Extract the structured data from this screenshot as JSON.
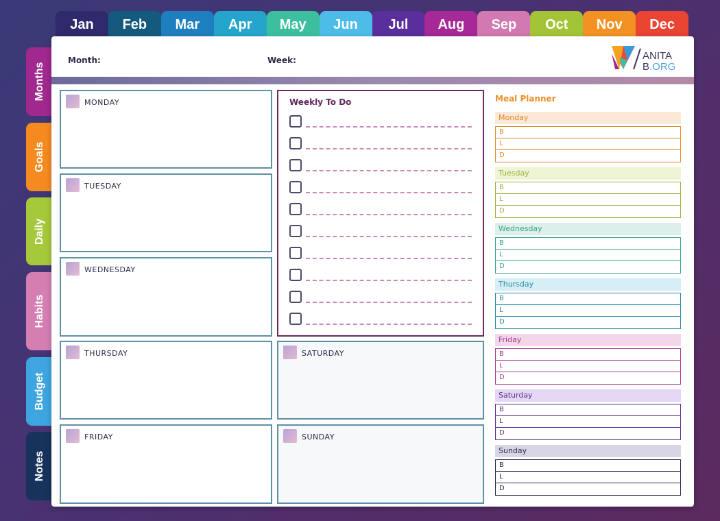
{
  "month_tabs": [
    {
      "label": "Jan",
      "color": "#2e2a6c"
    },
    {
      "label": "Feb",
      "color": "#135a7e"
    },
    {
      "label": "Mar",
      "color": "#1e7fc0"
    },
    {
      "label": "Apr",
      "color": "#25a5cc"
    },
    {
      "label": "May",
      "color": "#3bbf9f"
    },
    {
      "label": "Jun",
      "color": "#4dbde8"
    },
    {
      "label": "Jul",
      "color": "#5a2f9c"
    },
    {
      "label": "Aug",
      "color": "#a62997"
    },
    {
      "label": "Sep",
      "color": "#d179b0"
    },
    {
      "label": "Oct",
      "color": "#a3c437"
    },
    {
      "label": "Nov",
      "color": "#f39223"
    },
    {
      "label": "Dec",
      "color": "#ea4432"
    }
  ],
  "side_tabs": [
    {
      "label": "Months",
      "color": "#a0288e"
    },
    {
      "label": "Goals",
      "color": "#f48a20"
    },
    {
      "label": "Daily",
      "color": "#a5c93a"
    },
    {
      "label": "Habits",
      "color": "#d57eb2"
    },
    {
      "label": "Budget",
      "color": "#3ea5e0"
    },
    {
      "label": "Notes",
      "color": "#17335c"
    }
  ],
  "header": {
    "month_label": "Month:",
    "week_label": "Week:"
  },
  "logo": {
    "line1": "ANITA",
    "line2_b": "B",
    "line2_org": ".ORG"
  },
  "days": {
    "monday": "MONDAY",
    "tuesday": "TUESDAY",
    "wednesday": "WEDNESDAY",
    "thursday": "THURSDAY",
    "friday": "FRIDAY",
    "saturday": "SATURDAY",
    "sunday": "SUNDAY"
  },
  "todo": {
    "title": "Weekly To Do"
  },
  "meal_planner": {
    "title": "Meal Planner",
    "days": [
      {
        "name": "Monday",
        "head_bg": "#fce8d6",
        "color": "#e38c2c"
      },
      {
        "name": "Tuesday",
        "head_bg": "#eef4d4",
        "color": "#98b33a"
      },
      {
        "name": "Wednesday",
        "head_bg": "#dcefea",
        "color": "#3aa38a"
      },
      {
        "name": "Thursday",
        "head_bg": "#d6eef6",
        "color": "#2a8aa8"
      },
      {
        "name": "Friday",
        "head_bg": "#f4d6ea",
        "color": "#a63a92"
      },
      {
        "name": "Saturday",
        "head_bg": "#e4d6f4",
        "color": "#5a2f8c"
      },
      {
        "name": "Sunday",
        "head_bg": "#d8d6e4",
        "color": "#2d2a4a"
      }
    ],
    "meals": [
      "B",
      "L",
      "D"
    ]
  }
}
